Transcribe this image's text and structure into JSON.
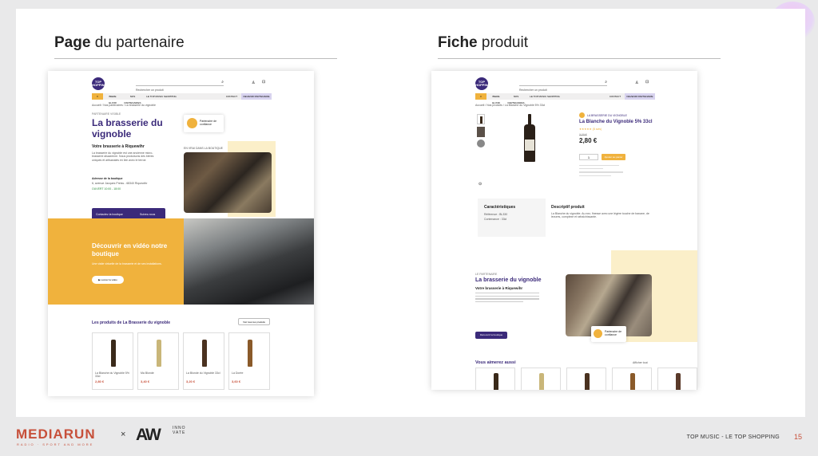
{
  "slide": {
    "left_title_bold": "Page",
    "left_title_rest": " du partenaire",
    "right_title_bold": "Fiche",
    "right_title_rest": " produit"
  },
  "partner_page": {
    "logo_text": "TOP SHOPPING",
    "search_placeholder": "Rechercher un produit",
    "nav": [
      "",
      "BIERE ELIXIR",
      "NOS PARTENAIRES",
      "LE TOP MUSIC SHOPPING",
      "CONTACT",
      "DEVENIR PARTENAIRE"
    ],
    "breadcrumb": "Accueil  /  Nos partenaires  /  La brasserie du vignoble",
    "kicker": "PARTENAIRE VISIBLE",
    "title": "La brasserie du vignoble",
    "subtitle": "Votre brasserie à Riquewihr",
    "description": "La brasserie du vignoble est une ancienne micro-brasserie alsacienne. Nous produisons des bières uniques et artisanales en lien avec le terroir.",
    "address_label": "Adresse de la boutique",
    "address": "6, avenue Jacques Preiss - 68340 Riquewihr",
    "hours": "OUVERT  10:00 - 18:00",
    "badge": "Partenaire de confiance",
    "photo_caption": "EN VRAI DANS LA BOUTIQUE",
    "contact_label": "Contactez la boutique",
    "follow_label": "Suivez-nous",
    "video_title": "Découvrir en vidéo notre boutique",
    "video_text": "Une visite virtuelle de la brasserie et de ses installations.",
    "video_button": "Lancer la vidéo",
    "products_title": "Les produits de La Brasserie du vignoble",
    "products_button": "Voir tous les produits",
    "products": [
      {
        "name": "La Blanche du Vignoble 5% 33cl",
        "price": "2,80 €"
      },
      {
        "name": "Ma Blonde",
        "price": "3,40 €"
      },
      {
        "name": "La Blonde du Vignoble 33cl",
        "price": "3,20 €"
      },
      {
        "name": "La Dorée",
        "price": "3,60 €"
      }
    ]
  },
  "product_page": {
    "breadcrumb": "Accueil  /  Nos produits  /  La Blanche du Vignoble 5% 33cl",
    "seller": "LA BRASSERIE DU VIGNOBLE",
    "name": "La Blanche du Vignoble 5% 33cl",
    "rating": "★★★★★  (8 avis)",
    "old_price": "3,20 €",
    "price": "2,80 €",
    "add_button": "Ajouter au panier",
    "char_title": "Caractéristiques",
    "char_rows": [
      "Référence : BL330",
      "Contenance : 33cl"
    ],
    "desc_title": "Descriptif produit",
    "desc_text": "La Blanche du vignoble. Au nez, finesse avec une légère touche de banane, de levures, complexe et rafraîchissante.",
    "partner_kicker": "LE PARTENAIRE",
    "partner_title": "La brasserie du vignoble",
    "partner_subtitle": "Votre brasserie à Riquewihr",
    "partner_button": "Découvrir la boutique",
    "partner_badge": "Partenaire de confiance",
    "more_title": "Vous aimerez aussi",
    "more_link": "Afficher tout"
  },
  "footer": {
    "brand1": "MEDIARUN",
    "brand1_sub": "RADIO · SPORT AND MORE",
    "times": "×",
    "brand2": "AW",
    "brand2_sub": "INNOVATE",
    "caption": "TOP MUSIC - LE TOP SHOPPING",
    "page": "15"
  },
  "colors": {
    "purple": "#3b2a7a",
    "orange": "#f0b23d",
    "pale_yellow": "#fbefc9",
    "accent_red": "#c7503a"
  }
}
